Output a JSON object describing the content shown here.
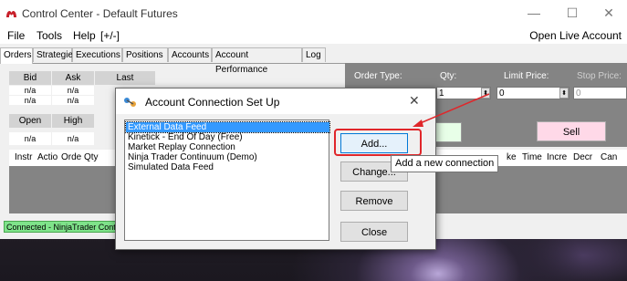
{
  "window": {
    "title": "Control Center - Default Futures",
    "controls": {
      "minimize": "—",
      "maximize": "☐",
      "close": "✕"
    }
  },
  "menu": {
    "items": [
      "File",
      "Tools",
      "Help",
      "[+/-]"
    ],
    "open_live": "Open Live Account"
  },
  "tabs": [
    "Orders",
    "Strategies",
    "Executions",
    "Positions",
    "Accounts",
    "Account Performance",
    "Log"
  ],
  "quotes": {
    "headers1": [
      "Bid",
      "Ask",
      "Last"
    ],
    "row1a": [
      "n/a",
      "n/a"
    ],
    "row1b": [
      "n/a",
      "n/a"
    ],
    "headers2": [
      "Open",
      "High"
    ],
    "row2": [
      "n/a",
      "n/a"
    ]
  },
  "order": {
    "type_label": "Order Type:",
    "qty_label": "Qty:",
    "limit_label": "Limit Price:",
    "stop_label": "Stop Price:",
    "qty_value": "1",
    "limit_value": "0",
    "stop_value": "0",
    "sell_label": "Sell"
  },
  "grid": {
    "columns_left": [
      "Instr",
      "Actio",
      "Orde",
      "Qty"
    ],
    "columns_right": [
      "ke",
      "Time",
      "Incre",
      "Decr",
      "Can"
    ]
  },
  "status": {
    "connection": "Connected - NinjaTrader Continuum (Demo)"
  },
  "dialog": {
    "title": "Account Connection Set Up",
    "close": "✕",
    "connections": [
      "External Data Feed",
      "Kinetick - End Of Day (Free)",
      "Market Replay Connection",
      "Ninja Trader Continuum (Demo)",
      "Simulated Data Feed"
    ],
    "selected_index": 0,
    "buttons": {
      "add": "Add...",
      "change": "Change...",
      "remove": "Remove",
      "close": "Close"
    },
    "tooltip": "Add a new connection"
  },
  "colors": {
    "highlight": "#e0262a",
    "selection": "#3399ff",
    "connected": "#7fe38a"
  }
}
